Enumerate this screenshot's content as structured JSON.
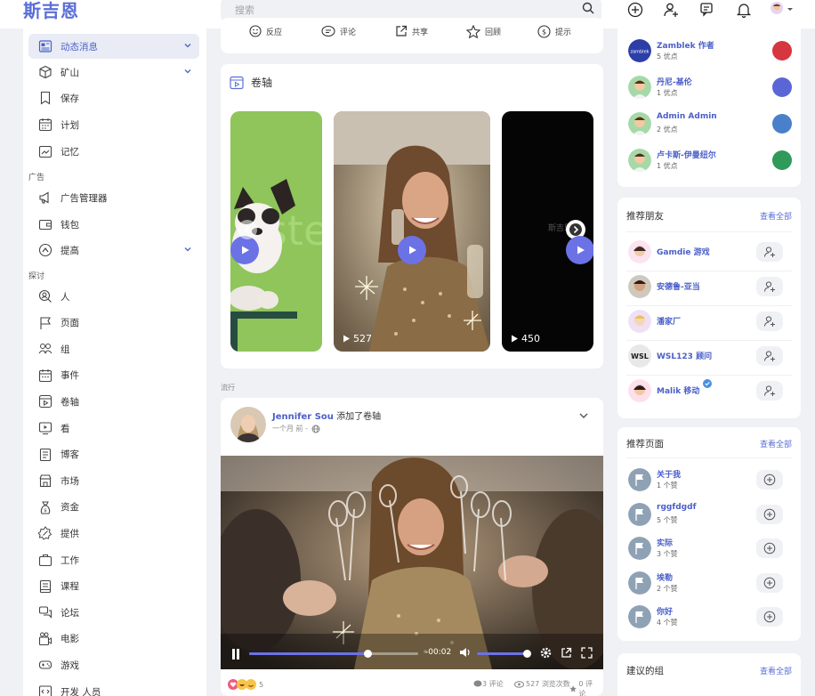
{
  "app": {
    "logo": "斯吉恩"
  },
  "search": {
    "placeholder": "搜索"
  },
  "sidebar": {
    "items": [
      {
        "label": "动态消息",
        "icon": "news-feed-icon",
        "chevron": true,
        "active": true
      },
      {
        "label": "矿山",
        "icon": "cube-icon",
        "chevron": true
      },
      {
        "label": "保存",
        "icon": "bookmark-icon"
      },
      {
        "label": "计划",
        "icon": "calendar-icon"
      },
      {
        "label": "记忆",
        "icon": "memories-icon"
      }
    ],
    "section_ads": "广告",
    "ads_items": [
      {
        "label": "广告管理器",
        "icon": "megaphone-icon"
      },
      {
        "label": "钱包",
        "icon": "wallet-icon"
      },
      {
        "label": "提高",
        "icon": "boost-icon",
        "chevron": true
      }
    ],
    "section_explore": "探讨",
    "explore_items": [
      {
        "label": "人",
        "icon": "people-search-icon"
      },
      {
        "label": "页面",
        "icon": "flag-icon"
      },
      {
        "label": "组",
        "icon": "group-icon"
      },
      {
        "label": "事件",
        "icon": "event-calendar-icon"
      },
      {
        "label": "卷轴",
        "icon": "reels-icon"
      },
      {
        "label": "看",
        "icon": "watch-icon"
      },
      {
        "label": "博客",
        "icon": "blog-icon"
      },
      {
        "label": "市场",
        "icon": "store-icon"
      },
      {
        "label": "资金",
        "icon": "funding-icon"
      },
      {
        "label": "提供",
        "icon": "offers-icon"
      },
      {
        "label": "工作",
        "icon": "briefcase-icon"
      },
      {
        "label": "课程",
        "icon": "courses-icon"
      },
      {
        "label": "论坛",
        "icon": "forum-icon"
      },
      {
        "label": "电影",
        "icon": "movie-icon"
      },
      {
        "label": "游戏",
        "icon": "game-icon"
      },
      {
        "label": "开发 人员",
        "icon": "developer-icon"
      }
    ]
  },
  "actionbar": {
    "react": "反应",
    "comment": "评论",
    "share": "共享",
    "review": "回顾",
    "tip": "提示"
  },
  "reels": {
    "title": "卷轴",
    "items": [
      {
        "count": ""
      },
      {
        "count": "527"
      },
      {
        "count": "450",
        "overlay": "斯吉恩"
      }
    ]
  },
  "feed": {
    "label": "流行",
    "post": {
      "author": "Jennifer Sou",
      "action": "添加了卷轴",
      "time": "一个月 前 -",
      "video_time": "-00:02",
      "reactions_count": "5",
      "comments": "3 评论",
      "views": "527 浏览次数",
      "reviews": "0 评论"
    }
  },
  "right": {
    "top_list": [
      {
        "name": "Zamblek 作者",
        "sub": "5 优点"
      },
      {
        "name": "丹尼-基伦",
        "sub": "1 优点"
      },
      {
        "name": "Admin Admin",
        "sub": "2 优点"
      },
      {
        "name": "卢卡斯-伊曼纽尔",
        "sub": "1 优点"
      }
    ],
    "friends": {
      "title": "推荐朋友",
      "see_all": "查看全部",
      "items": [
        {
          "name": "Gamdie 游戏"
        },
        {
          "name": "安德鲁-亚当"
        },
        {
          "name": "潘家厂"
        },
        {
          "name": "WSL123 顾问"
        },
        {
          "name": "Malik 移动"
        }
      ]
    },
    "pages": {
      "title": "推荐页面",
      "see_all": "查看全部",
      "items": [
        {
          "name": "关于我",
          "sub": "1 个赞"
        },
        {
          "name": "rggfdgdf",
          "sub": "5 个赞"
        },
        {
          "name": "实际",
          "sub": "3 个赞"
        },
        {
          "name": "埃勒",
          "sub": "2 个赞"
        },
        {
          "name": "你好",
          "sub": "4 个赞"
        }
      ]
    },
    "groups": {
      "title": "建议的组",
      "see_all": "查看全部"
    }
  },
  "colors": {
    "accent": "#5a6fd6",
    "link": "#4b5fc9",
    "play": "#6b72e6"
  }
}
